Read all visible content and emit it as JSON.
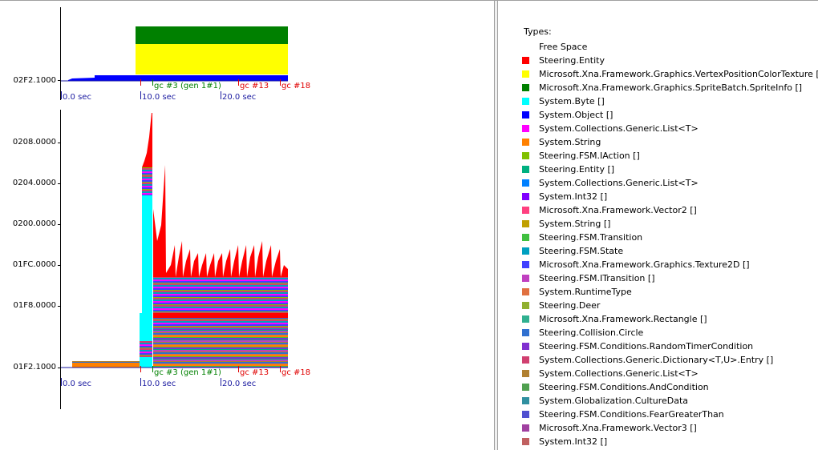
{
  "top_chart": {
    "y_label": "02F2.1000",
    "time_labels": [
      "0.0 sec",
      "10.0 sec",
      "20.0 sec"
    ],
    "gc_labels": [
      {
        "text": "gc #3 (gen 1#1)",
        "color": "#008000"
      },
      {
        "text": "gc #13",
        "color": "#e00000"
      },
      {
        "text": "gc #18",
        "color": "#e00000"
      }
    ]
  },
  "bottom_chart": {
    "y_labels": [
      "0208.0000",
      "0204.0000",
      "0200.0000",
      "01FC.0000",
      "01F8.0000",
      "01F2.1000"
    ],
    "time_labels": [
      "0.0 sec",
      "10.0 sec",
      "20.0 sec"
    ],
    "gc_labels": [
      {
        "text": "gc #3 (gen 1#1)",
        "color": "#008000"
      },
      {
        "text": "gc #13",
        "color": "#e00000"
      },
      {
        "text": "gc #18",
        "color": "#e00000"
      }
    ]
  },
  "legend": {
    "title": "Types:",
    "items": [
      {
        "label": "Free Space",
        "color": "#ffffff"
      },
      {
        "label": "Steering.Entity",
        "color": "#ff0000"
      },
      {
        "label": "Microsoft.Xna.Framework.Graphics.VertexPositionColorTexture []",
        "color": "#ffff00"
      },
      {
        "label": "Microsoft.Xna.Framework.Graphics.SpriteBatch.SpriteInfo []",
        "color": "#008000"
      },
      {
        "label": "System.Byte []",
        "color": "#00ffff"
      },
      {
        "label": "System.Object []",
        "color": "#0000ff"
      },
      {
        "label": "System.Collections.Generic.List<T>",
        "color": "#ff00ff"
      },
      {
        "label": "System.String",
        "color": "#ff8000"
      },
      {
        "label": "Steering.FSM.IAction []",
        "color": "#80c000"
      },
      {
        "label": "Steering.Entity []",
        "color": "#00b080"
      },
      {
        "label": "System.Collections.Generic.List<T>",
        "color": "#0080ff"
      },
      {
        "label": "System.Int32 []",
        "color": "#8000ff"
      },
      {
        "label": "Microsoft.Xna.Framework.Vector2 []",
        "color": "#ff4080"
      },
      {
        "label": "System.String []",
        "color": "#c0a000"
      },
      {
        "label": "Steering.FSM.Transition",
        "color": "#40c040"
      },
      {
        "label": "Steering.FSM.State",
        "color": "#00a0c0"
      },
      {
        "label": "Microsoft.Xna.Framework.Graphics.Texture2D []",
        "color": "#4040ff"
      },
      {
        "label": "Steering.FSM.ITransition []",
        "color": "#c040c0"
      },
      {
        "label": "System.RuntimeType",
        "color": "#e07040"
      },
      {
        "label": "Steering.Deer",
        "color": "#90b030"
      },
      {
        "label": "Microsoft.Xna.Framework.Rectangle []",
        "color": "#30b090"
      },
      {
        "label": "Steering.Collision.Circle",
        "color": "#3070d0"
      },
      {
        "label": "Steering.FSM.Conditions.RandomTimerCondition",
        "color": "#8030d0"
      },
      {
        "label": "System.Collections.Generic.Dictionary<T,U>.Entry []",
        "color": "#d04070"
      },
      {
        "label": "System.Collections.Generic.List<T>",
        "color": "#b08030"
      },
      {
        "label": "Steering.FSM.Conditions.AndCondition",
        "color": "#50a050"
      },
      {
        "label": "System.Globalization.CultureData",
        "color": "#3090a0"
      },
      {
        "label": "Steering.FSM.Conditions.FearGreaterThan",
        "color": "#5050d0"
      },
      {
        "label": "Microsoft.Xna.Framework.Vector3 []",
        "color": "#a040a0"
      },
      {
        "label": "System.Int32 []",
        "color": "#c06060"
      }
    ]
  }
}
